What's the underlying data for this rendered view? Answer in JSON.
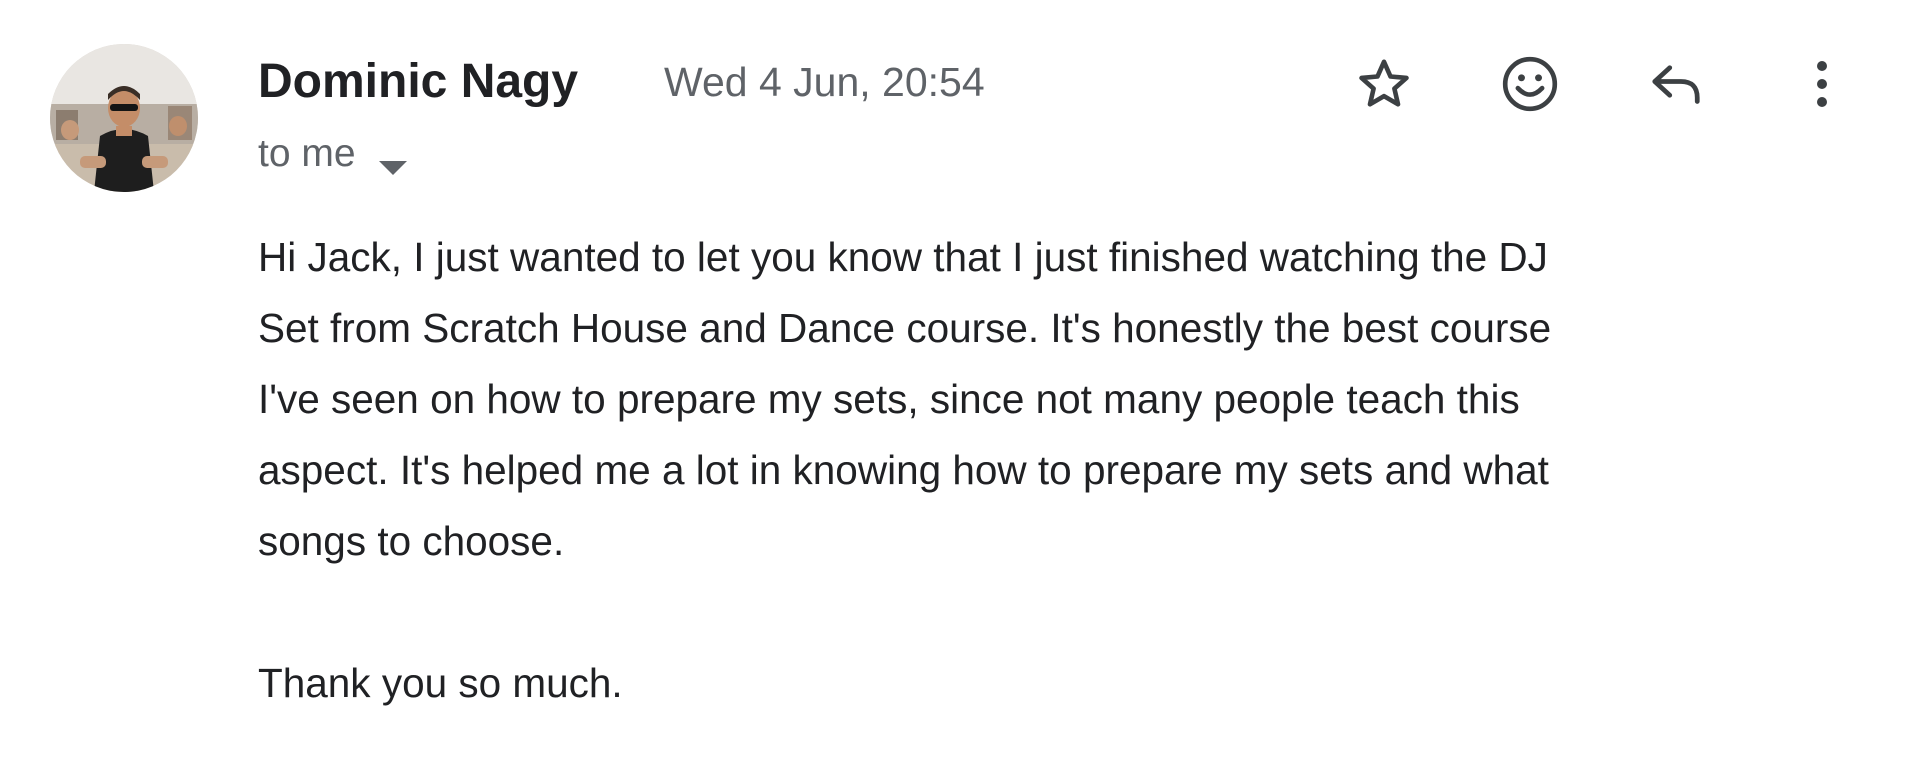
{
  "message": {
    "sender_name": "Dominic Nagy",
    "date": "Wed 4 Jun, 20:54",
    "recipient_label": "to me",
    "avatar": {
      "icon": "contact-photo"
    },
    "actions": [
      {
        "name": "star",
        "icon": "star-outline-icon"
      },
      {
        "name": "react",
        "icon": "smiley-icon"
      },
      {
        "name": "reply",
        "icon": "reply-arrow-icon"
      },
      {
        "name": "more",
        "icon": "more-vertical-icon"
      }
    ],
    "body_lines": [
      "Hi Jack, I just wanted to let you know that I just finished watching the DJ",
      "Set from Scratch House and Dance course. It's honestly the best course",
      "I've seen on how to prepare my sets, since not many people teach this",
      "aspect. It's helped me a lot in knowing how to prepare my sets and what",
      "songs to choose."
    ],
    "signoff": "Thank you so much."
  },
  "colors": {
    "text_primary": "#202124",
    "text_secondary": "#5f6368",
    "icon": "#3c4043"
  }
}
